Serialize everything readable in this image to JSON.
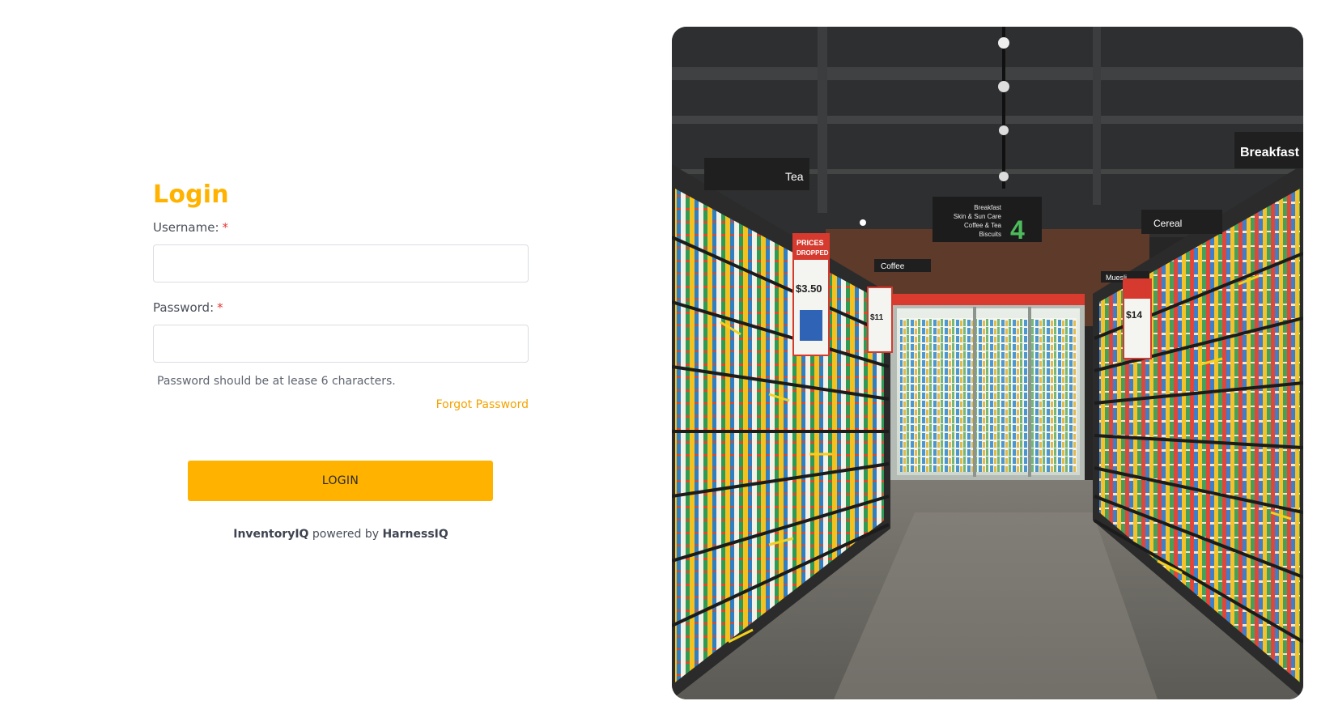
{
  "login": {
    "title": "Login",
    "username_label": "Username:",
    "password_label": "Password:",
    "required_mark": "*",
    "username_value": "",
    "password_value": "",
    "password_hint": "Password should be at lease 6 characters.",
    "forgot_link": "Forgot Password",
    "submit_label": "LOGIN"
  },
  "footer": {
    "brand": "InventoryIQ",
    "powered_by": "powered by",
    "vendor": "HarnessIQ"
  },
  "photo": {
    "signs": {
      "tea": "Tea",
      "breakfast": "Breakfast",
      "cereal": "Cereal",
      "coffee": "Coffee",
      "muesli": "Muesli",
      "aisle_number": "4",
      "aisle_list": [
        "Breakfast",
        "Skin & Sun Care",
        "Coffee & Tea",
        "Biscuits"
      ],
      "prices_dropped": [
        "PRICES",
        "DROPPED"
      ],
      "price_left": "$3.50",
      "price_right": "$14",
      "price_small": "$11"
    }
  },
  "colors": {
    "accent": "#ffb300",
    "link": "#f5a300",
    "required": "#e53935"
  }
}
